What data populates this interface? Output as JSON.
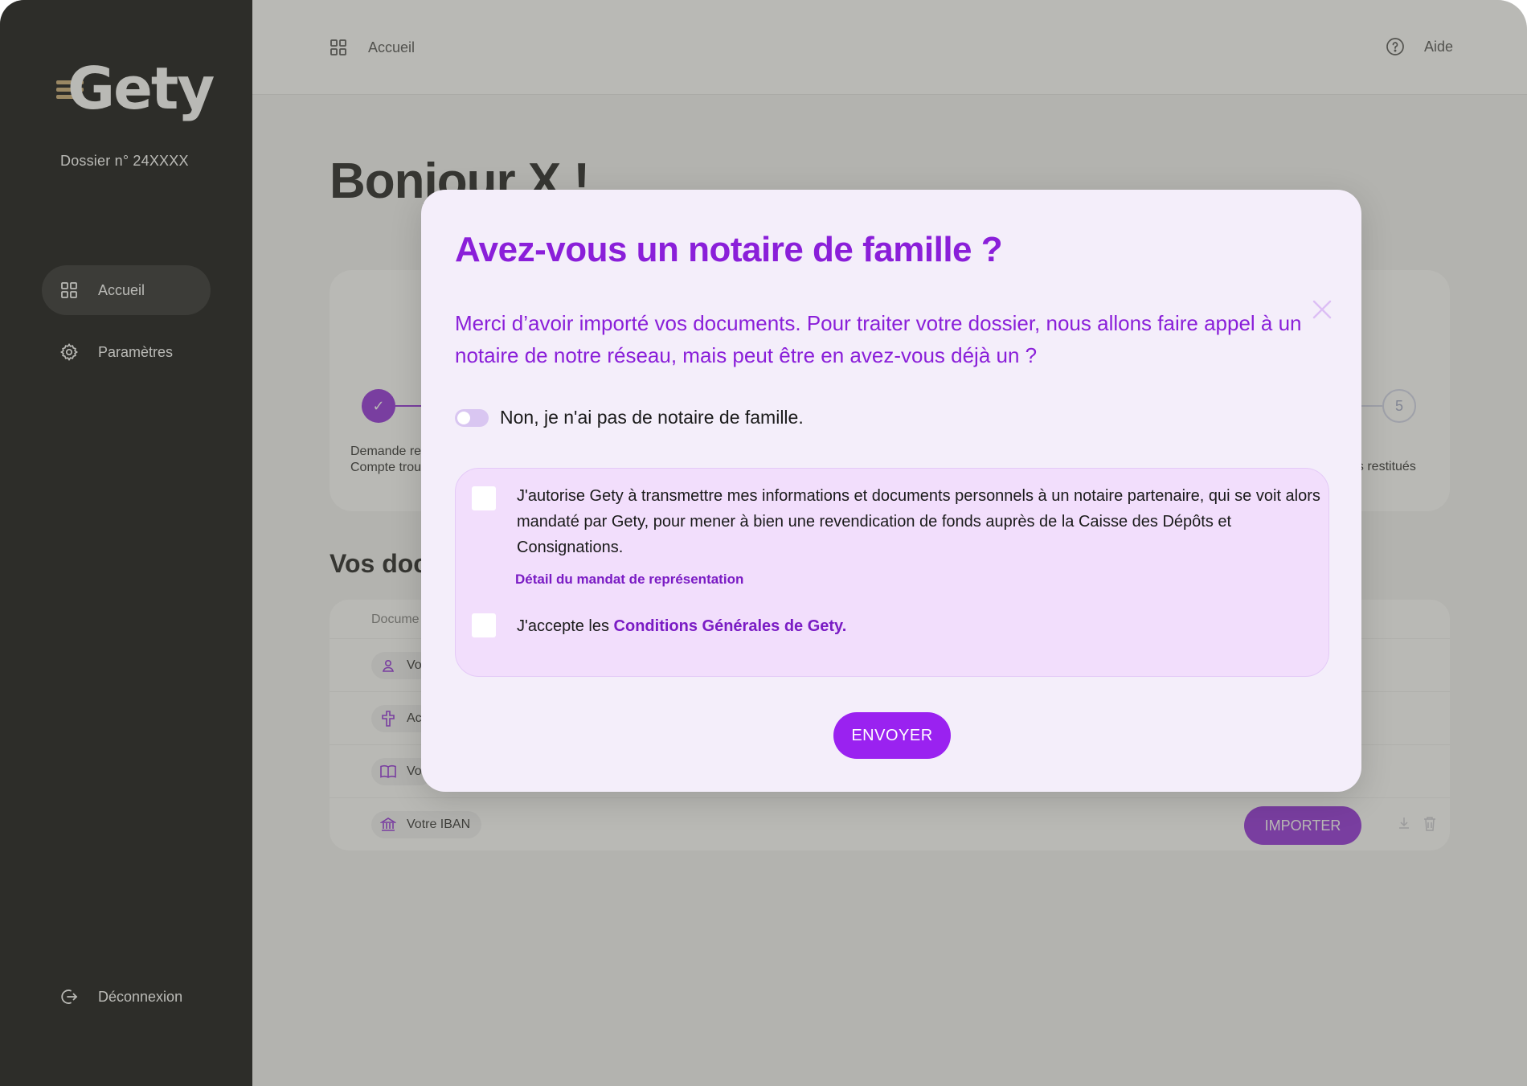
{
  "sidebar": {
    "logo": "Gety",
    "dossier": "Dossier n° 24XXXX",
    "items": [
      {
        "label": "Accueil",
        "icon": "grid-icon"
      },
      {
        "label": "Paramètres",
        "icon": "gear-icon"
      }
    ],
    "logout": "Déconnexion"
  },
  "header": {
    "breadcrumb": "Accueil",
    "help": "Aide"
  },
  "main": {
    "greeting": "Bonjour X !",
    "steps": {
      "first_label": "Demande re\nCompte trou",
      "last_number": "5",
      "last_label": "ds restitués"
    },
    "docs_title": "Vos docu",
    "docs_header": "Docume",
    "docs": [
      {
        "label": "Vo",
        "icon": "person-icon"
      },
      {
        "label": "Ac",
        "icon": "cross-icon"
      },
      {
        "label": "Vo",
        "icon": "book-icon"
      },
      {
        "label": "Votre IBAN",
        "icon": "bank-icon"
      }
    ],
    "import_label": "IMPORTER"
  },
  "modal": {
    "title": "Avez-vous un notaire de famille ?",
    "intro": "Merci d’avoir importé vos documents. Pour traiter votre dossier, nous allons faire appel à un notaire de notre réseau, mais peut être en avez-vous déjà un ?",
    "toggle_label": "Non, je n'ai pas de notaire de famille.",
    "consent_text": "J'autorise Gety à transmettre mes informations et documents personnels à un notaire partenaire, qui se voit alors mandaté par Gety, pour mener à bien une revendication de fonds auprès de la Caisse des Dépôts et Consignations.",
    "mandate_link": "Détail du mandat de représentation",
    "cgu_prefix": "J'accepte les ",
    "cgu_link": "Conditions Générales de Gety.",
    "send_label": "ENVOYER"
  },
  "colors": {
    "accent": "#8a1fd9",
    "sidebar_bg": "#000000",
    "modal_bg": "#f4eefa",
    "consent_bg": "#f2defc"
  }
}
